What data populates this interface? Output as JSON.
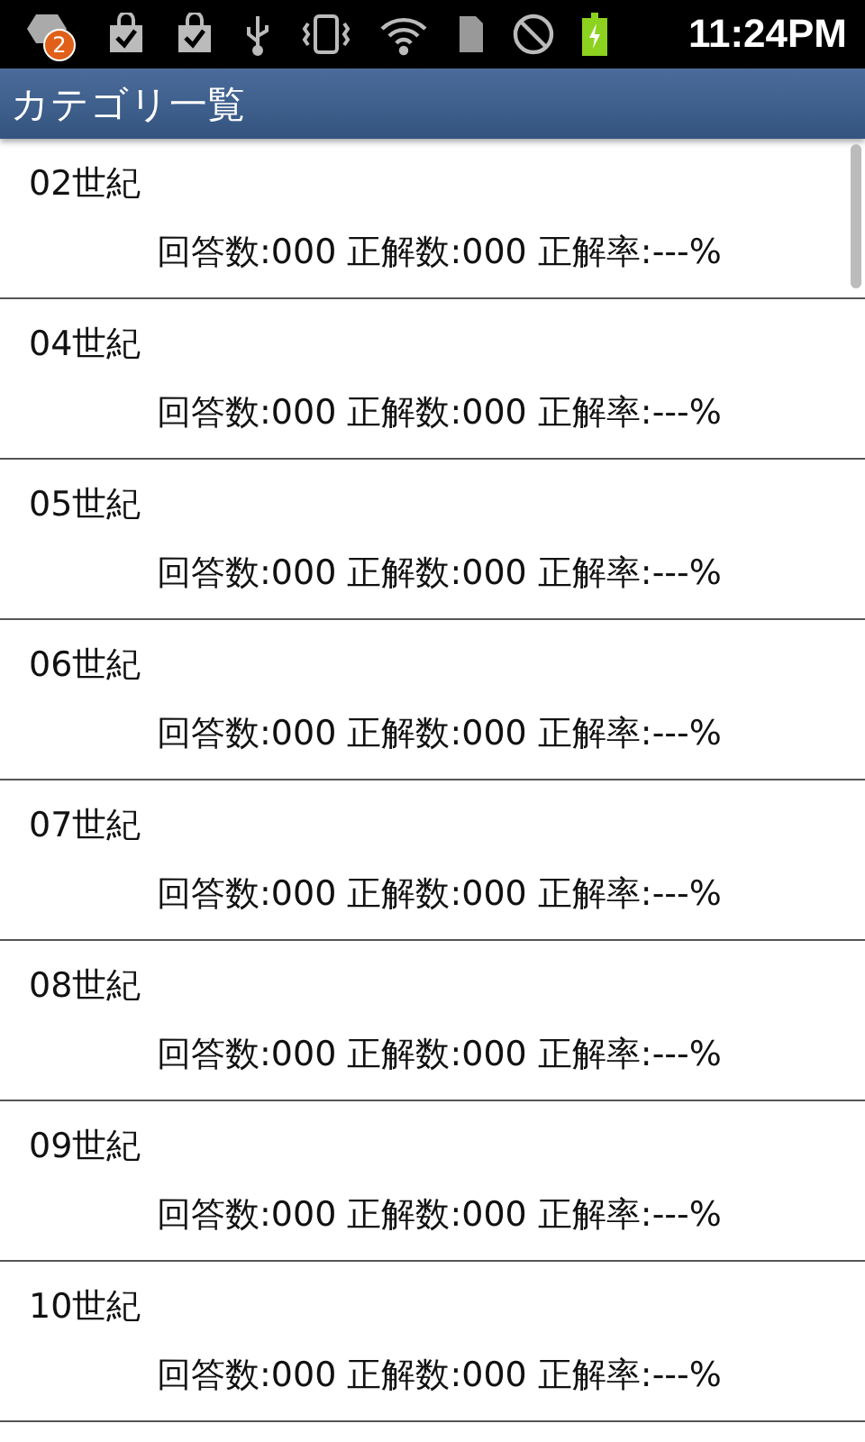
{
  "status_bar": {
    "notification_count": "2",
    "time": "11:24PM",
    "battery_charging": true
  },
  "title_bar": {
    "title": "カテゴリ一覧"
  },
  "categories": [
    {
      "name": "02世紀",
      "stats": "回答数:000 正解数:000 正解率:---%"
    },
    {
      "name": "04世紀",
      "stats": "回答数:000 正解数:000 正解率:---%"
    },
    {
      "name": "05世紀",
      "stats": "回答数:000 正解数:000 正解率:---%"
    },
    {
      "name": "06世紀",
      "stats": "回答数:000 正解数:000 正解率:---%"
    },
    {
      "name": "07世紀",
      "stats": "回答数:000 正解数:000 正解率:---%"
    },
    {
      "name": "08世紀",
      "stats": "回答数:000 正解数:000 正解率:---%"
    },
    {
      "name": "09世紀",
      "stats": "回答数:000 正解数:000 正解率:---%"
    },
    {
      "name": "10世紀",
      "stats": "回答数:000 正解数:000 正解率:---%"
    }
  ]
}
